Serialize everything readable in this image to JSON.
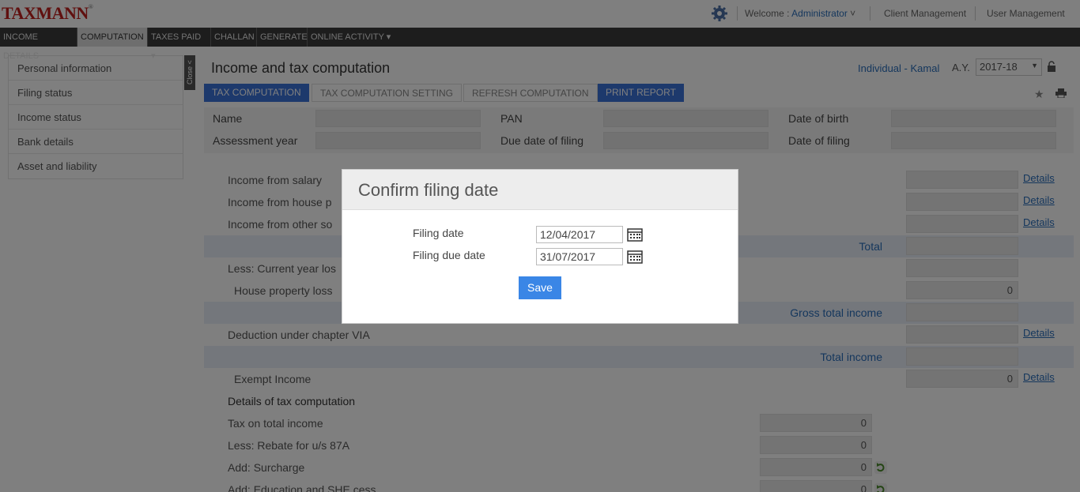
{
  "app": {
    "logo": "TAXMANN",
    "logo_mark": "®"
  },
  "topnav": {
    "welcome_prefix": "Welcome :",
    "user": "Administrator",
    "user_caret": "˅",
    "client_management": "Client Management",
    "user_management": "User Management"
  },
  "menu": [
    {
      "label": "INCOME DETAILS"
    },
    {
      "label": "COMPUTATION"
    },
    {
      "label": "TAXES PAID ▾"
    },
    {
      "label": "CHALLAN"
    },
    {
      "label": "GENERATE"
    },
    {
      "label": "ONLINE ACTIVITY ▾"
    }
  ],
  "sidebar": {
    "items": [
      {
        "label": "Personal information"
      },
      {
        "label": "Filing status"
      },
      {
        "label": "Income status"
      },
      {
        "label": "Bank details"
      },
      {
        "label": "Asset and liability"
      }
    ],
    "close_label": "Close <"
  },
  "main": {
    "title": "Income and tax computation",
    "assessee": "Individual - Kamal",
    "ay_label": "A.Y.",
    "ay_value": "2017-18",
    "ay_caret": "▼",
    "buttons": {
      "tax_computation": "TAX COMPUTATION",
      "tax_computation_setting": "TAX COMPUTATION SETTING",
      "refresh_computation": "REFRESH COMPUTATION",
      "print_report": "PRINT REPORT"
    },
    "info": {
      "name": "Name",
      "pan": "PAN",
      "dob": "Date of birth",
      "assessment_year": "Assessment year",
      "due_date": "Due date of filing",
      "date_of_filing": "Date of filing"
    },
    "rows": {
      "salary": "Income from salary",
      "house": "Income from house p",
      "other": "Income from other so",
      "total": "Total",
      "current_loss": "Less: Current year los",
      "house_loss": "House property loss",
      "house_loss_value": "0",
      "gross_total": "Gross total income",
      "deduction": "Deduction under chapter VIA",
      "total_income": "Total income",
      "exempt": "Exempt Income",
      "exempt_value": "0",
      "details_heading": "Details of tax computation",
      "tax_total": "Tax on total income",
      "tax_total_value": "0",
      "rebate": "Less: Rebate for u/s 87A",
      "rebate_value": "0",
      "surcharge": "Add: Surcharge",
      "surcharge_value": "0",
      "cess": "Add: Education and SHE cess",
      "cess_value": "0",
      "details_link": "Details"
    }
  },
  "modal": {
    "title": "Confirm filing date",
    "filing_date_label": "Filing date",
    "filing_date_value": "12/04/2017",
    "filing_due_label": "Filing due date",
    "filing_due_value": "31/07/2017",
    "save": "Save"
  },
  "colors": {
    "brand": "#c0211f",
    "primary": "#3a72d8",
    "link": "#2a6ebb"
  }
}
